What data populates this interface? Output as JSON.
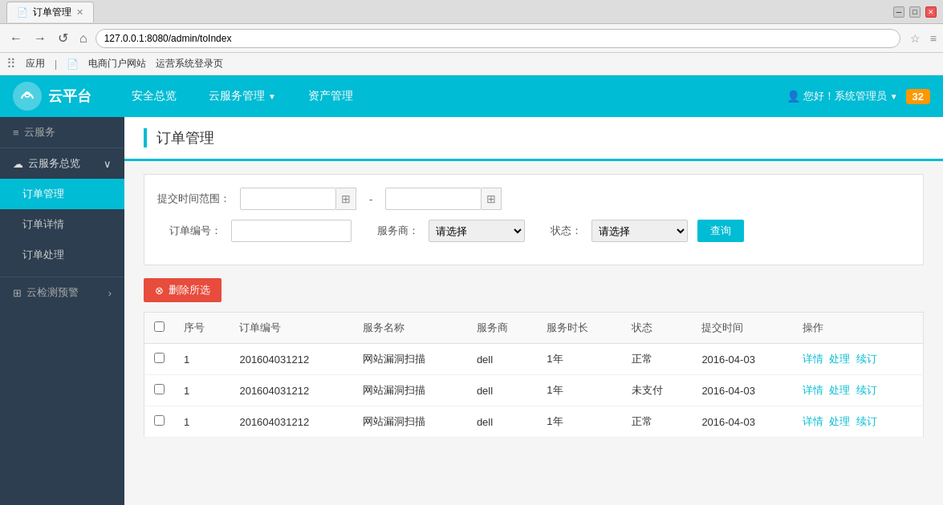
{
  "browser": {
    "tab_title": "订单管理",
    "tab_favicon": "📄",
    "address": "127.0.0.1:8080/admin/toIndex",
    "bookmarks": [
      "应用",
      "电商门户网站",
      "运营系统登录页"
    ]
  },
  "topnav": {
    "logo_text": "云平台",
    "nav_links": [
      {
        "label": "安全总览",
        "id": "nav-security"
      },
      {
        "label": "云服务管理",
        "id": "nav-cloud",
        "has_arrow": true
      },
      {
        "label": "资产管理",
        "id": "nav-assets"
      }
    ],
    "user_text": "您好！系统管理员",
    "notification_count": "32"
  },
  "sidebar": {
    "section_title": "云服务",
    "parent_item": "云服务总览",
    "items": [
      {
        "label": "订单管理",
        "active": true
      },
      {
        "label": "订单详情",
        "active": false
      },
      {
        "label": "订单处理",
        "active": false
      }
    ],
    "section2_title": "云检测预警"
  },
  "page": {
    "title": "订单管理",
    "filter": {
      "date_label": "提交时间范围：",
      "date_placeholder1": "",
      "date_placeholder2": "",
      "order_label": "订单编号：",
      "vendor_label": "服务商：",
      "vendor_placeholder": "请选择",
      "status_label": "状态：",
      "status_placeholder": "请选择",
      "query_btn": "查询"
    },
    "delete_btn": "删除所选",
    "table": {
      "headers": [
        "",
        "序号",
        "订单编号",
        "服务名称",
        "服务商",
        "服务时长",
        "状态",
        "提交时间",
        "操作"
      ],
      "rows": [
        {
          "seq": "1",
          "order_no": "201604031212",
          "service": "网站漏洞扫描",
          "vendor": "dell",
          "duration": "1年",
          "status": "正常",
          "status_type": "normal",
          "submit_time": "2016-04-03",
          "actions": [
            "详情",
            "处理",
            "续订"
          ]
        },
        {
          "seq": "1",
          "order_no": "201604031212",
          "service": "网站漏洞扫描",
          "vendor": "dell",
          "duration": "1年",
          "status": "未支付",
          "status_type": "unpaid",
          "submit_time": "2016-04-03",
          "actions": [
            "详情",
            "处理",
            "续订"
          ]
        },
        {
          "seq": "1",
          "order_no": "201604031212",
          "service": "网站漏洞扫描",
          "vendor": "dell",
          "duration": "1年",
          "status": "正常",
          "status_type": "normal",
          "submit_time": "2016-04-03",
          "actions": [
            "详情",
            "处理",
            "续订"
          ]
        }
      ]
    }
  }
}
